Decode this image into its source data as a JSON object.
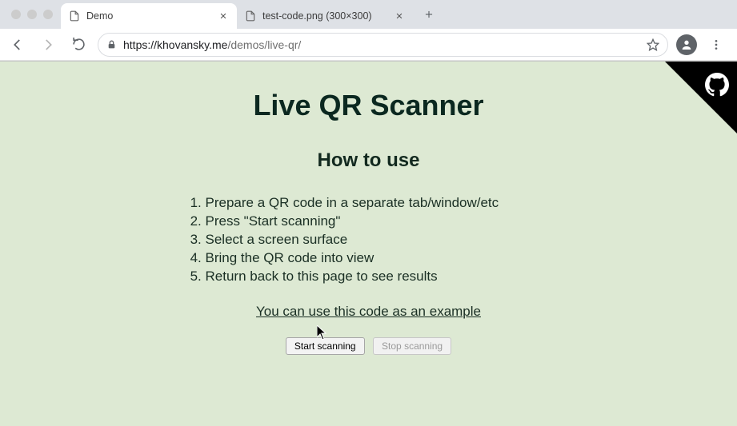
{
  "browser": {
    "tabs": [
      {
        "title": "Demo",
        "active": true
      },
      {
        "title": "test-code.png (300×300)",
        "active": false
      }
    ],
    "url_host": "https://khovansky.me",
    "url_path": "/demos/live-qr/"
  },
  "page": {
    "title": "Live QR Scanner",
    "subtitle": "How to use",
    "steps": [
      "Prepare a QR code in a separate tab/window/etc",
      "Press \"Start scanning\"",
      "Select a screen surface",
      "Bring the QR code into view",
      "Return back to this page to see results"
    ],
    "example_link": "You can use this code as an example",
    "start_button": "Start scanning",
    "stop_button": "Stop scanning"
  }
}
